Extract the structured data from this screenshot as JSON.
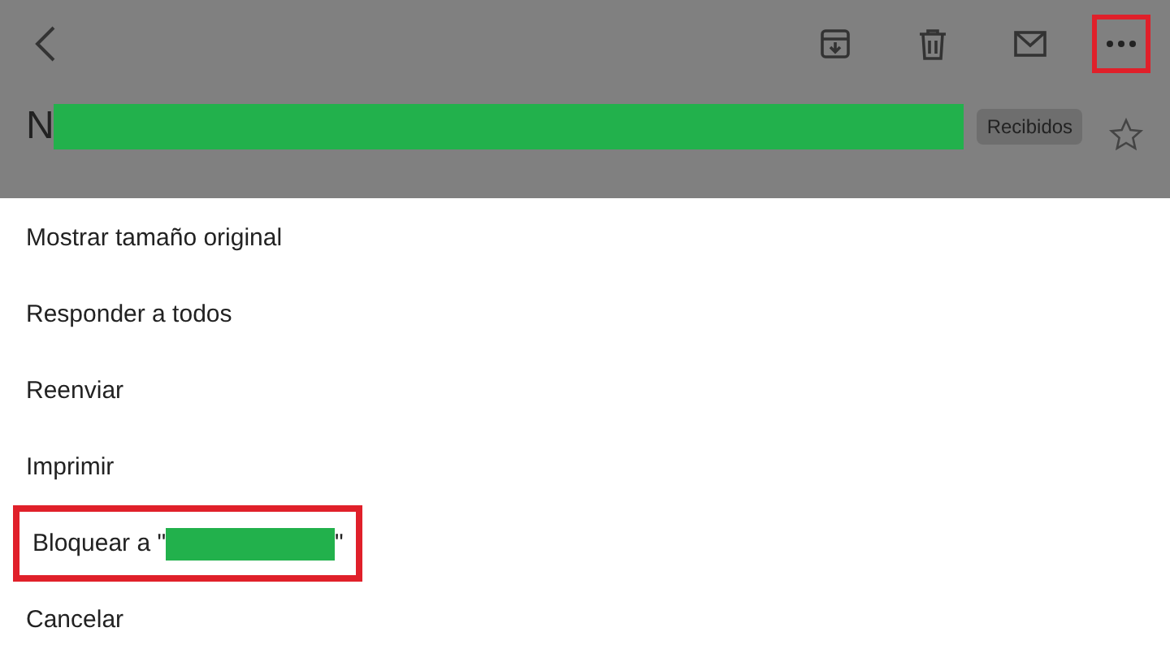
{
  "toolbar": {
    "more_highlighted": true
  },
  "message": {
    "subject": "N",
    "subject_redacted": true,
    "label": "Recibidos",
    "starred": false
  },
  "menu": [
    {
      "label": "Mostrar tamaño original",
      "highlighted": false
    },
    {
      "label": "Responder a todos",
      "highlighted": false
    },
    {
      "label": "Reenviar",
      "highlighted": false
    },
    {
      "label": "Imprimir",
      "highlighted": false
    },
    {
      "label": "Bloquear a \"",
      "label_end": "\"",
      "redacted": true,
      "highlighted": true
    },
    {
      "label": "Cancelar",
      "highlighted": false
    }
  ]
}
